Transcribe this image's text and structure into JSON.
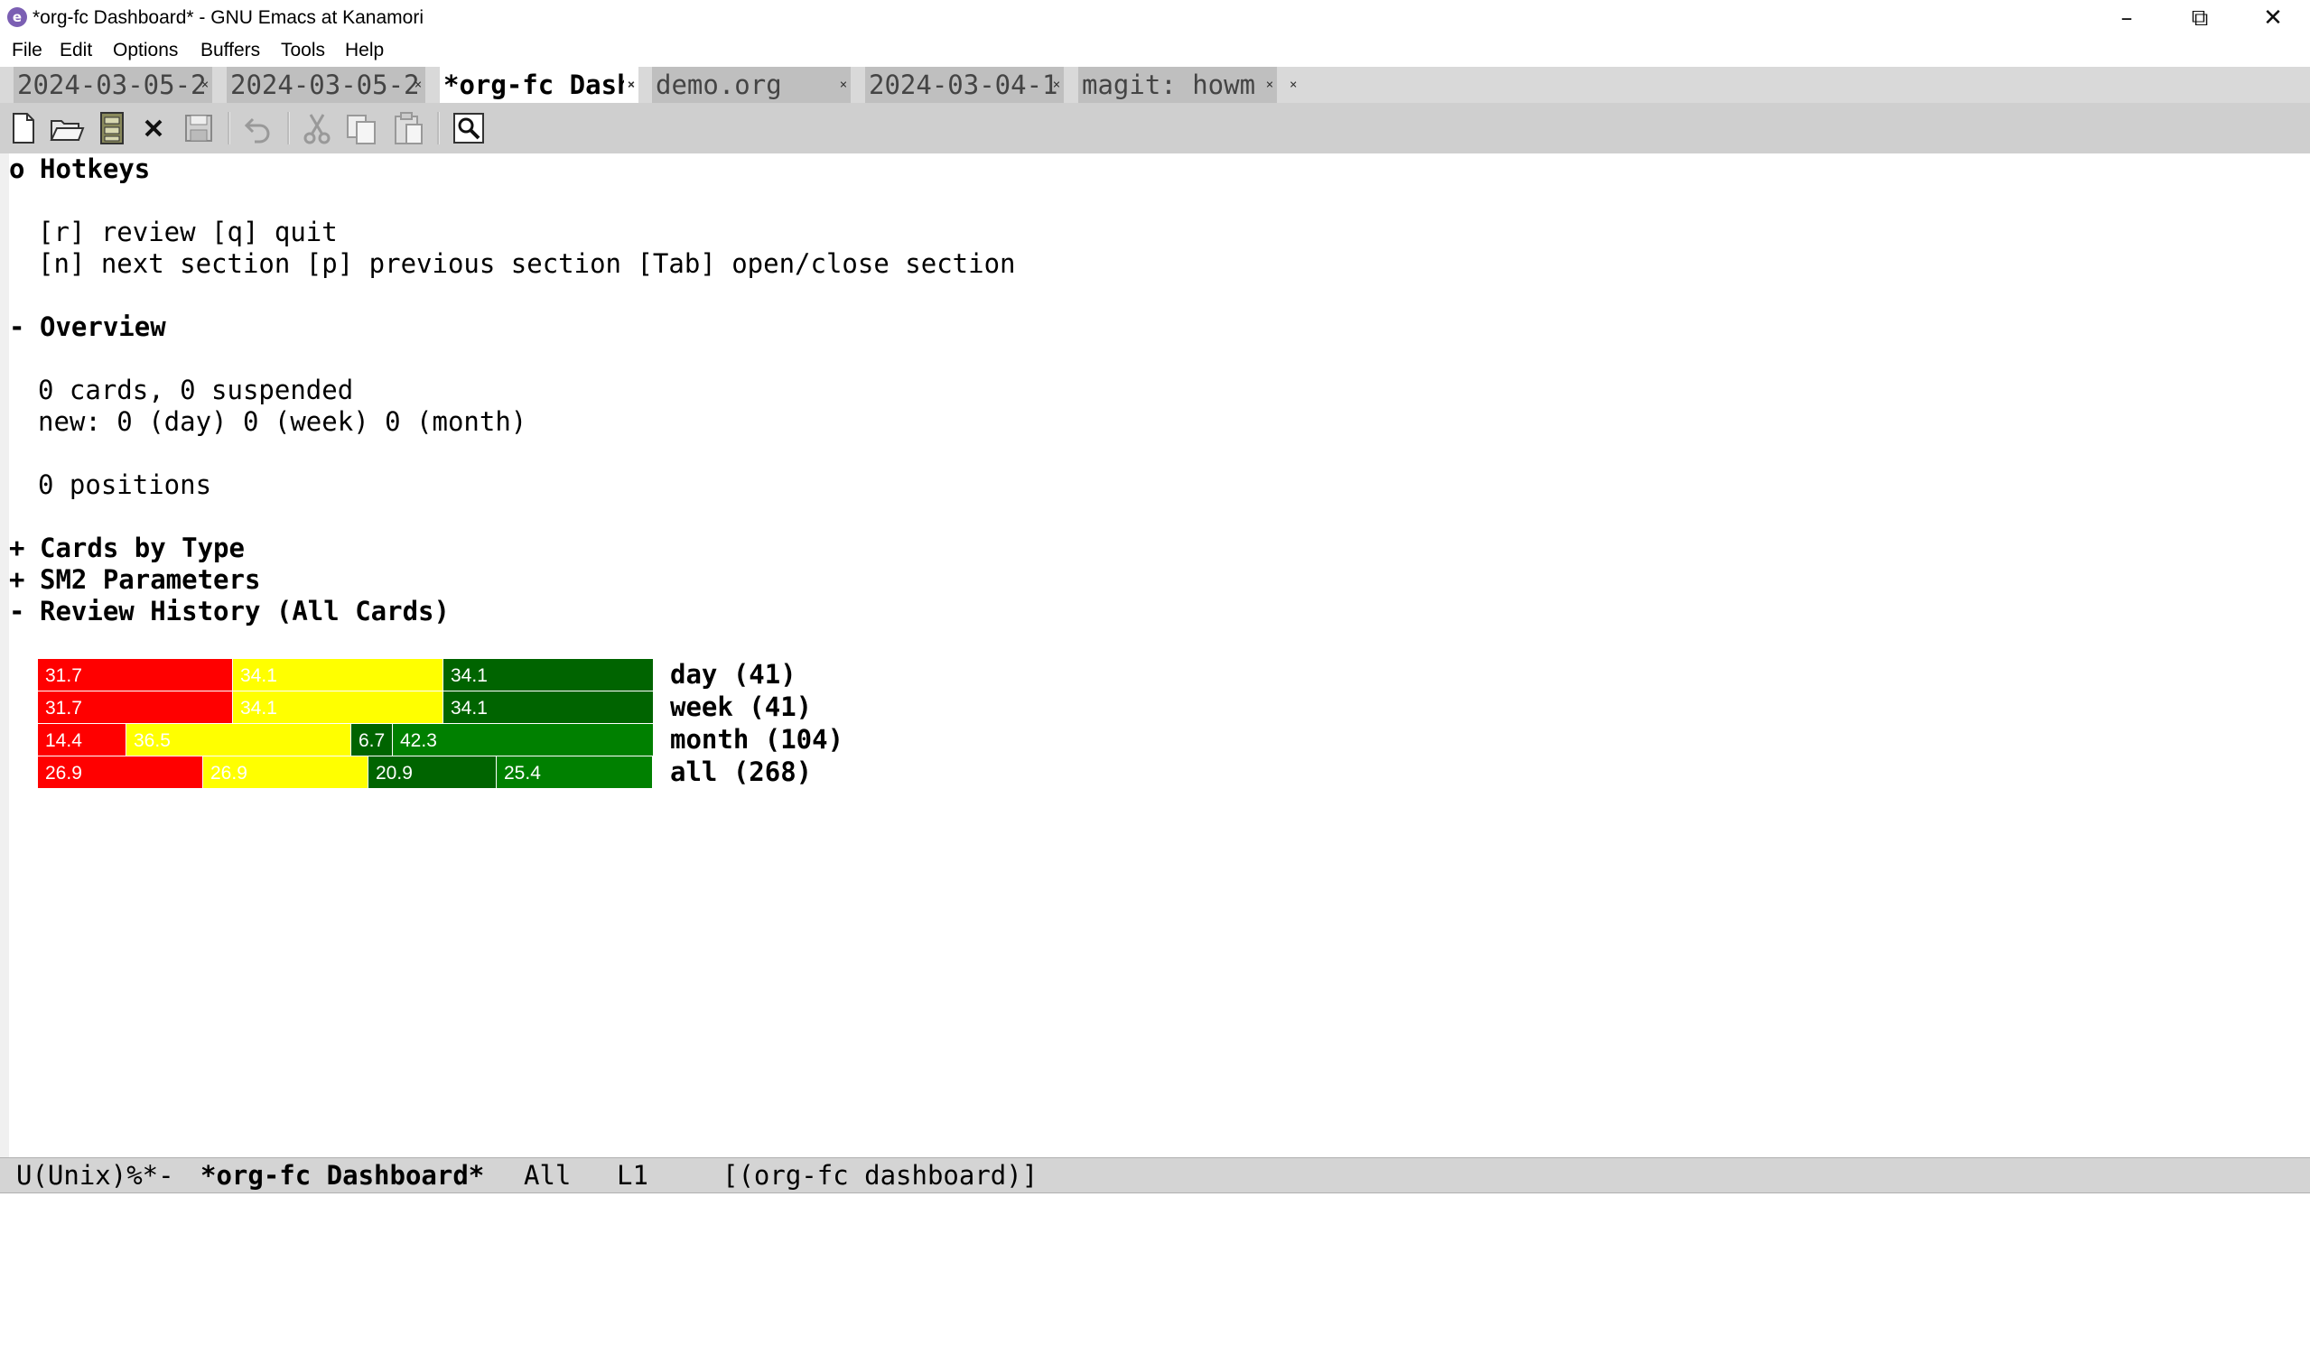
{
  "window": {
    "title": "*org-fc Dashboard* - GNU Emacs at Kanamori",
    "app_icon": "emacs-icon",
    "controls": [
      "minimize-icon",
      "restore-icon",
      "close-icon"
    ]
  },
  "menubar": {
    "items": [
      "File",
      "Edit",
      "Options",
      "Buffers",
      "Tools",
      "Help"
    ]
  },
  "tabs": {
    "items": [
      {
        "label": "2024-03-05-2",
        "active": false
      },
      {
        "label": "2024-03-05-2",
        "active": false
      },
      {
        "label": "*org-fc Dash",
        "active": true
      },
      {
        "label": "demo.org",
        "active": false
      },
      {
        "label": "2024-03-04-1",
        "active": false
      },
      {
        "label": "magit: howm",
        "active": false
      }
    ],
    "close_glyph": "×"
  },
  "toolbar": {
    "icons": [
      "new-file-icon",
      "open-file-icon",
      "dired-icon",
      "kill-buffer-icon",
      "save-icon",
      "undo-icon",
      "cut-icon",
      "copy-icon",
      "paste-icon",
      "search-icon"
    ]
  },
  "buffer": {
    "hotkeys": {
      "marker": "o",
      "title": "Hotkeys",
      "line1": "[r] review [q] quit",
      "line2": "[n] next section [p] previous section [Tab] open/close section"
    },
    "overview": {
      "marker": "-",
      "title": "Overview",
      "cards": "0 cards, 0 suspended",
      "new": "new: 0 (day) 0 (week) 0 (month)",
      "positions": "0 positions"
    },
    "cards_by_type": {
      "marker": "+",
      "title": "Cards by Type"
    },
    "sm2": {
      "marker": "+",
      "title": "SM2 Parameters"
    },
    "review_history": {
      "marker": "-",
      "title": "Review History (All Cards)"
    }
  },
  "chart_data": {
    "type": "bar",
    "stacked": true,
    "colors": [
      "#ff0000",
      "#ffff00",
      "#006400",
      "#008000",
      "#006400"
    ],
    "rows": [
      {
        "label": "day (41)",
        "segments": [
          31.7,
          34.1,
          34.1
        ]
      },
      {
        "label": "week (41)",
        "segments": [
          31.7,
          34.1,
          34.1
        ]
      },
      {
        "label": "month (104)",
        "segments": [
          14.4,
          36.5,
          6.7,
          42.3
        ]
      },
      {
        "label": "all (268)",
        "segments": [
          26.9,
          26.9,
          20.9,
          25.4
        ]
      }
    ]
  },
  "modeline": {
    "status": "U(Unix)%*-",
    "buffer_name": "*org-fc Dashboard*",
    "position": "All",
    "line": "L1",
    "mode": "[(org-fc dashboard)]"
  }
}
